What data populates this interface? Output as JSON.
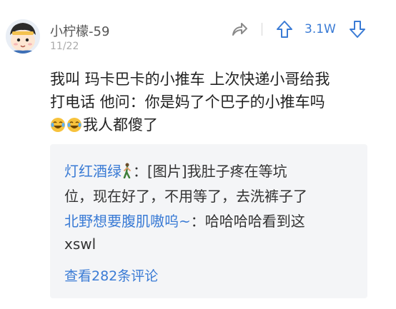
{
  "post": {
    "username": "小柠檬-59",
    "date": "11/22",
    "vote_count": "3.1W",
    "body_line1": "我叫 玛卡巴卡的小推车 上次快递小哥给我",
    "body_line2": "打电话 他问：你是妈了个巴子的小推车吗",
    "body_line3": "我人都傻了"
  },
  "comments": [
    {
      "author": "灯红酒绿",
      "sep": "：",
      "line1": "[图片]我肚子疼在等坑",
      "line2": "位，现在好了，不用等了，去洗裤子了"
    },
    {
      "author": "北野想要腹肌嗷呜~",
      "sep": "：",
      "line1": "哈哈哈哈看到这",
      "line2": "xswl"
    }
  ],
  "view_all_label": "查看282条评论",
  "colors": {
    "accent": "#3a7bd5",
    "comment_bg": "#f4f5f7",
    "text": "#222222"
  },
  "icons": [
    "avatar",
    "share-icon",
    "upvote-icon",
    "downvote-icon",
    "laughing-tears-emoji",
    "walking-person-emoji"
  ]
}
